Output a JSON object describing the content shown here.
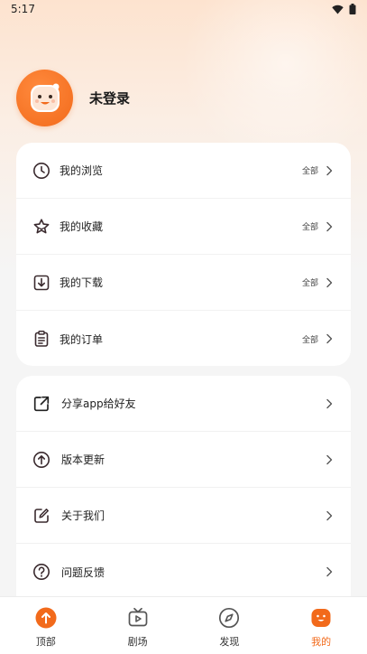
{
  "status_bar": {
    "time": "5:17"
  },
  "profile": {
    "name": "未登录"
  },
  "card1": {
    "items": [
      {
        "label": "我的浏览",
        "all": "全部"
      },
      {
        "label": "我的收藏",
        "all": "全部"
      },
      {
        "label": "我的下载",
        "all": "全部"
      },
      {
        "label": "我的订单",
        "all": "全部"
      }
    ]
  },
  "card2": {
    "items": [
      {
        "label": "分享app给好友"
      },
      {
        "label": "版本更新"
      },
      {
        "label": "关于我们"
      },
      {
        "label": "问题反馈"
      }
    ]
  },
  "tabbar": {
    "tabs": [
      {
        "label": "顶部",
        "icon": "arrow-up-circle-icon"
      },
      {
        "label": "剧场",
        "icon": "tv-play-icon"
      },
      {
        "label": "发现",
        "icon": "compass-icon"
      },
      {
        "label": "我的",
        "icon": "smiley-face-icon"
      }
    ],
    "active_index": 3
  },
  "colors": {
    "accent": "#f26a1b",
    "text": "#222222",
    "background": "#f5f5f5"
  }
}
